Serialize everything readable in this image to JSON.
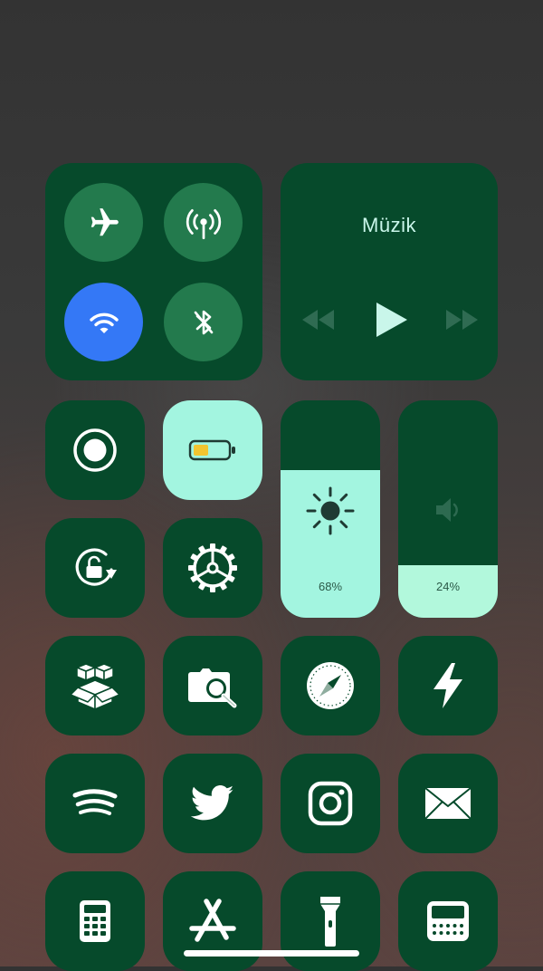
{
  "connectivity": {
    "airplane": {
      "icon": "airplane-icon",
      "active": false
    },
    "cellular": {
      "icon": "cellular-antenna-icon",
      "active": false
    },
    "wifi": {
      "icon": "wifi-icon",
      "active": true
    },
    "bluetooth": {
      "icon": "bluetooth-off-icon",
      "active": false
    }
  },
  "music": {
    "title": "Müzik",
    "controls": [
      "rewind-icon",
      "play-icon",
      "fast-forward-icon"
    ]
  },
  "brightness": {
    "value": 68,
    "label": "68%",
    "icon": "sun-icon"
  },
  "volume": {
    "value": 24,
    "label": "24%",
    "icon": "speaker-icon"
  },
  "tiles": [
    "screen-record-icon",
    "low-power-battery-icon",
    "rotation-lock-icon",
    "settings-gear-icon",
    "package-boxes-icon",
    "photo-search-folder-icon",
    "safari-compass-icon",
    "flash-icon",
    "spotify-icon",
    "twitter-bird-icon",
    "instagram-icon",
    "mail-icon",
    "calculator-icon",
    "app-store-icon",
    "flashlight-icon",
    "radio-icon"
  ],
  "colors": {
    "tile_bg": "#064a2b",
    "button_bg": "#237a4d",
    "active_blue": "#3478f6",
    "accent_mint": "#a3f5e0",
    "volume_mint": "#b2f8dc",
    "battery_yellow": "#f2c531"
  }
}
